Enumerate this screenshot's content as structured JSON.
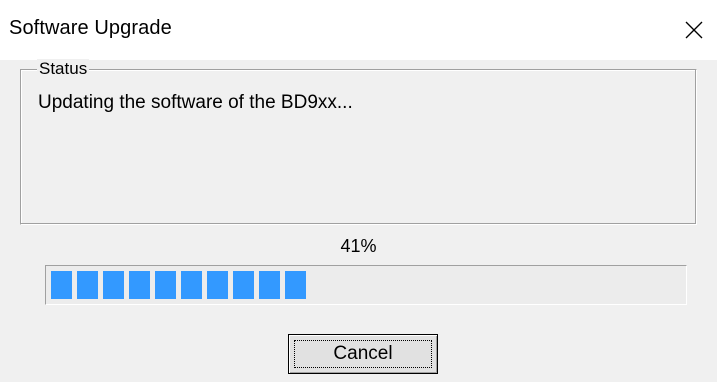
{
  "window": {
    "title": "Software Upgrade",
    "close_icon": "close-icon"
  },
  "status_group": {
    "label": "Status",
    "message": "Updating the software of the BD9xx..."
  },
  "progress": {
    "percent_text": "41%",
    "value": 0.41,
    "fill_color": "#3399ff"
  },
  "buttons": {
    "cancel_label": "Cancel"
  }
}
